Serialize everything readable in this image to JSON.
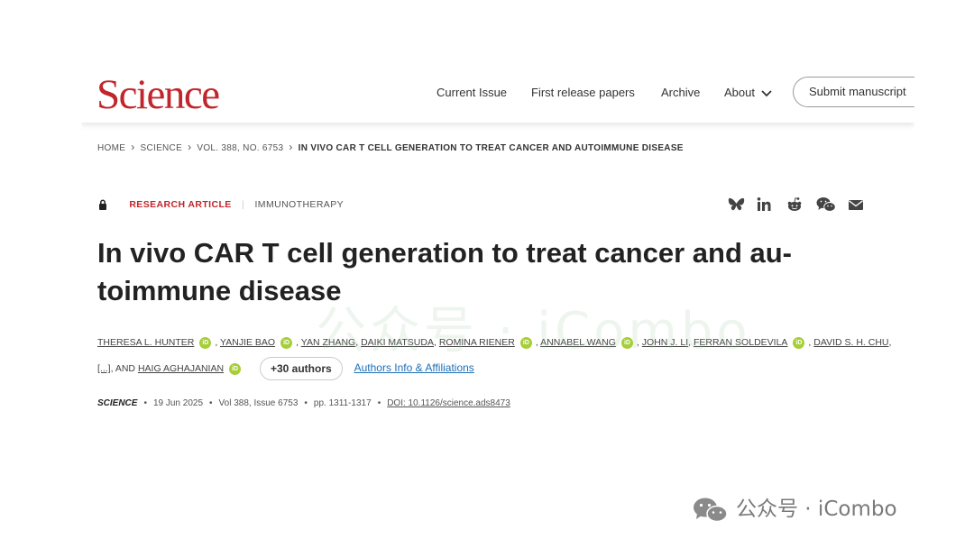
{
  "header": {
    "logo_text": "Science",
    "nav": [
      {
        "label": "Current Issue"
      },
      {
        "label": "First release papers"
      },
      {
        "label": "Archive"
      },
      {
        "label": "About"
      }
    ],
    "submit_label": "Submit manuscript"
  },
  "breadcrumb": [
    "HOME",
    "SCIENCE",
    "VOL. 388, NO. 6753",
    "IN VIVO CAR T CELL GENERATION TO TREAT CANCER AND AUTOIMMUNE DISEASE"
  ],
  "article": {
    "type": "RESEARCH ARTICLE",
    "subject": "IMMUNOTHERAPY",
    "title_line1": "In vivo CAR T cell generation to treat cancer and au-",
    "title_line2": "toimmune disease",
    "authors_line1": [
      {
        "name": "THERESA L. HUNTER",
        "orcid": true,
        "sep": ","
      },
      {
        "name": "YANJIE BAO",
        "orcid": true,
        "sep": ","
      },
      {
        "name": "YAN ZHANG",
        "orcid": false,
        "sep": ","
      },
      {
        "name": "DAIKI MATSUDA",
        "orcid": false,
        "sep": ","
      },
      {
        "name": "ROMINA RIENER",
        "orcid": true,
        "sep": ","
      },
      {
        "name": "ANNABEL WANG",
        "orcid": true,
        "sep": ","
      },
      {
        "name": "JOHN J. LI",
        "orcid": false,
        "sep": ","
      },
      {
        "name": "FERRAN SOLDEVILA",
        "orcid": true,
        "sep": ","
      },
      {
        "name": "DAVID S. H. CHU",
        "orcid": false,
        "sep": ","
      }
    ],
    "authors_ellipsis": "[...]",
    "authors_and": ", AND",
    "last_author": "HAIG AGHAJANIAN",
    "orcid_badge": "iD",
    "more_authors_label": "+30 authors",
    "affiliations_link": "Authors Info & Affiliations",
    "journal": "SCIENCE",
    "date": "19 Jun 2025",
    "volume_issue": "Vol 388, Issue 6753",
    "pages": "pp. 1311-1317",
    "doi": "DOI: 10.1126/science.ads8473"
  },
  "share_icons": [
    "bluesky-icon",
    "linkedin-icon",
    "reddit-icon",
    "wechat-icon",
    "email-icon"
  ],
  "watermark": {
    "overlay_text": "公众号 · iCombo",
    "footer_text": "公众号 · iCombo"
  },
  "colors": {
    "brand_red": "#c0262b",
    "link_blue": "#1c6fb8",
    "orcid_green": "#a6ce39"
  }
}
